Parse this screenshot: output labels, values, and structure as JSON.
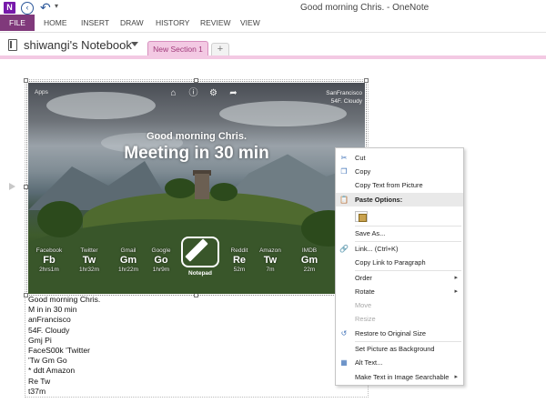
{
  "window": {
    "title": "Good morning Chris. - OneNote",
    "app_logo": "N"
  },
  "quick_access": {
    "back_icon": "back-arrow-icon",
    "forward_icon": "forward-arrow-icon",
    "undo_icon": "undo-icon",
    "more_icon": "customize-caret-icon"
  },
  "ribbon": {
    "tabs": [
      {
        "label": "FILE"
      },
      {
        "label": "HOME"
      },
      {
        "label": "INSERT"
      },
      {
        "label": "DRAW"
      },
      {
        "label": "HISTORY"
      },
      {
        "label": "REVIEW"
      },
      {
        "label": "VIEW"
      }
    ]
  },
  "notebook": {
    "name": "shiwangi's Notebook",
    "section_tab": "New Section 1",
    "add_tab": "+"
  },
  "picture": {
    "apps_label": "Apps",
    "location_line1": "SanFrancisco",
    "location_line2": "54F. Cloudy",
    "greeting": "Good morning Chris.",
    "headline": "Meeting in 30 min",
    "shortcuts": [
      {
        "name": "Facebook",
        "abbr": "Fb",
        "time": "2hrs1m"
      },
      {
        "name": "Twitter",
        "abbr": "Tw",
        "time": "1hr32m"
      },
      {
        "name": "Gmail",
        "abbr": "Gm",
        "time": "1hr22m"
      },
      {
        "name": "Google",
        "abbr": "Go",
        "time": "1hr9m"
      },
      {
        "name": "Reddit",
        "abbr": "Re",
        "time": "52m"
      },
      {
        "name": "Amazon",
        "abbr": "Tw",
        "time": "7m"
      },
      {
        "name": "IMDB",
        "abbr": "Gm",
        "time": "22m"
      }
    ],
    "notepad_label": "Notepad"
  },
  "ocr_text": [
    "Good morning Chris.",
    "M in in 30 min",
    "anFrancisco",
    "54F. Cloudy",
    "Gmj Pi",
    "FaceS00k 'Twitter",
    "'Tw Gm Go",
    "* ddt Amazon",
    "Re Tw",
    "t37m"
  ],
  "context_menu": {
    "items": [
      {
        "label": "Cut",
        "icon": "scissors-icon",
        "enabled": true
      },
      {
        "label": "Copy",
        "icon": "copy-icon",
        "enabled": true
      },
      {
        "label": "Copy Text from Picture",
        "icon": "",
        "enabled": true
      },
      {
        "label": "Paste Options:",
        "icon": "paste-icon",
        "enabled": true,
        "header": true
      },
      {
        "label": "Save As...",
        "icon": "",
        "enabled": true
      },
      {
        "label": "Link...  (Ctrl+K)",
        "icon": "link-icon",
        "enabled": true
      },
      {
        "label": "Copy Link to Paragraph",
        "icon": "",
        "enabled": true
      },
      {
        "label": "Order",
        "icon": "",
        "enabled": true,
        "submenu": true
      },
      {
        "label": "Rotate",
        "icon": "",
        "enabled": true,
        "submenu": true
      },
      {
        "label": "Move",
        "icon": "",
        "enabled": false
      },
      {
        "label": "Resize",
        "icon": "",
        "enabled": false
      },
      {
        "label": "Restore to Original Size",
        "icon": "restore-size-icon",
        "enabled": true
      },
      {
        "label": "Set Picture as Background",
        "icon": "",
        "enabled": true
      },
      {
        "label": "Alt Text...",
        "icon": "alt-text-icon",
        "enabled": true
      },
      {
        "label": "Make Text in Image Searchable",
        "icon": "",
        "enabled": true,
        "submenu": true
      }
    ]
  }
}
